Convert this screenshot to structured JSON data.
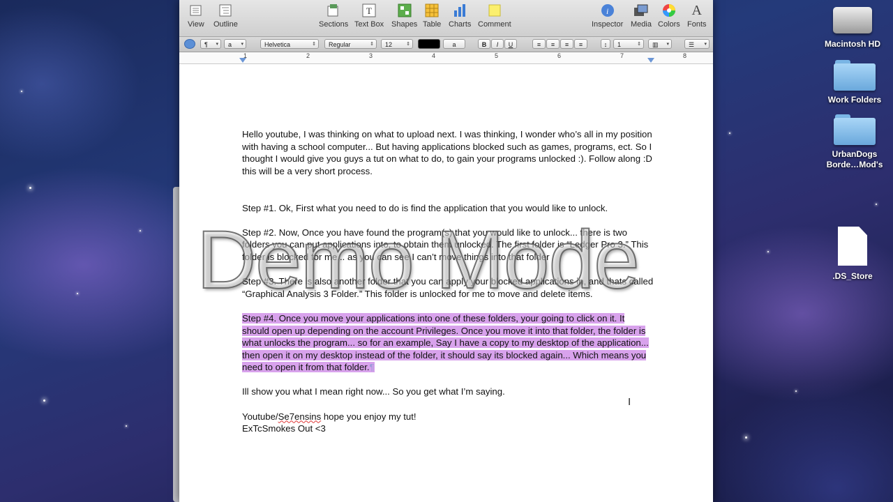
{
  "toolbar": {
    "view": "View",
    "outline": "Outline",
    "sections": "Sections",
    "textbox": "Text Box",
    "shapes": "Shapes",
    "table": "Table",
    "charts": "Charts",
    "comment": "Comment",
    "inspector": "Inspector",
    "media": "Media",
    "colors": "Colors",
    "fonts": "Fonts"
  },
  "format_bar": {
    "paragraph_style": "¶",
    "char_style": "a",
    "font_family": "Helvetica",
    "font_weight": "Regular",
    "font_size": "12",
    "text_color": "#000000",
    "highlight_label": "a",
    "bold": "B",
    "italic": "I",
    "underline": "U",
    "line_spacing": "1"
  },
  "ruler": {
    "numbers": [
      "1",
      "2",
      "3",
      "4",
      "5",
      "6",
      "7",
      "8"
    ]
  },
  "document": {
    "intro": "Hello youtube, I was thinking on what to upload next. I was thinking, I wonder who’s all in my position with having a school computer... But having applications blocked such as games, programs, ect. So I thought I would give you guys a tut on what to do, to gain your programs unlocked :). Follow along :D this will be a very short process.",
    "step1": "Step #1. Ok, First what you need to do is find the application that you would like to unlock.",
    "step2": "Step #2. Now, Once you have found the program(s) that you would like to unlock... there is two folders you can put applications into, to obtain them unlocked. The first folder is “Ledger Pro 3.” This folder is blocked for me... as you can see I can’t move things into that folder",
    "step3": "Step #3. There is also another folder that you can apply your blocked applications in, and thats called “Graphical Analysis 3 Folder.” This folder is unlocked for me to move and delete items.",
    "step4": "Step #4. Once you move your applications into one of these folders, your going to click on it. It should open up depending on the account Privileges.  Once you move it into that folder, the folder is what unlocks the program... so for an example, Say I have a copy to my desktop of the application... then open it on my desktop instead of the folder, it should say its blocked again... Which means you need to open it from that folder.",
    "pilcrow": "¶",
    "show": "Ill show you what I mean right now... So you get what I’m saying.",
    "signoff_prefix": "Youtube/",
    "signoff_name": "Se7ensins",
    "signoff_suffix": " hope you enjoy my tut!",
    "signoff2": "ExTcSmokes Out <3"
  },
  "watermark": "Demo Mode",
  "desktop": {
    "icons": [
      {
        "label": "Macintosh HD"
      },
      {
        "label": "Work Folders"
      },
      {
        "label": "UrbanDogs Borde…Mod's"
      },
      {
        "label": ".DS_Store"
      }
    ]
  },
  "colors": {
    "selection": "#d8a2ec",
    "folder": "#7ab6e6"
  }
}
